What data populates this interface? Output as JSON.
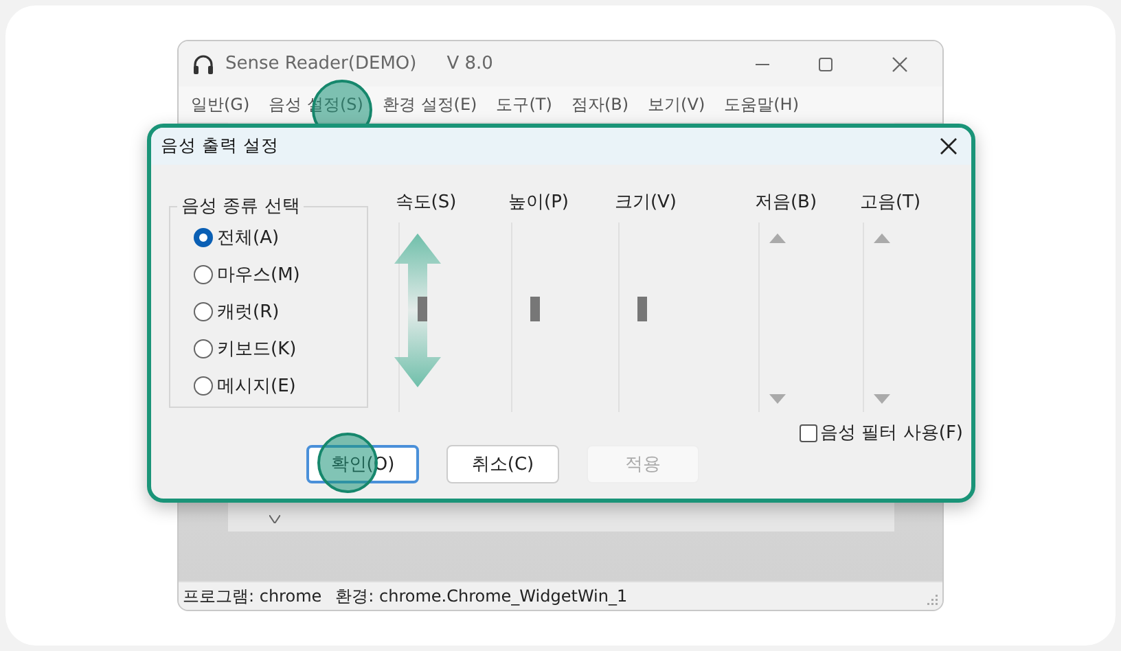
{
  "window": {
    "title": "Sense Reader(DEMO)",
    "version": "V 8.0"
  },
  "menu": [
    {
      "label": "일반(G)",
      "highlighted": false
    },
    {
      "label": "음성 설정(S)",
      "highlighted": true
    },
    {
      "label": "환경 설정(E)",
      "highlighted": false
    },
    {
      "label": "도구(T)",
      "highlighted": false
    },
    {
      "label": "점자(B)",
      "highlighted": false
    },
    {
      "label": "보기(V)",
      "highlighted": false
    },
    {
      "label": "도움말(H)",
      "highlighted": false
    }
  ],
  "dialog": {
    "title": "음성 출력 설정",
    "group": {
      "title": "음성 종류 선택",
      "options": [
        {
          "label": "전체(A)",
          "selected": true
        },
        {
          "label": "마우스(M)",
          "selected": false
        },
        {
          "label": "캐럿(R)",
          "selected": false
        },
        {
          "label": "키보드(K)",
          "selected": false
        },
        {
          "label": "메시지(E)",
          "selected": false
        }
      ]
    },
    "sliders": [
      {
        "label": "속도(S)",
        "kind": "thumb",
        "level": 0.55,
        "highlighted": true
      },
      {
        "label": "높이(P)",
        "kind": "thumb",
        "level": 0.55,
        "highlighted": false
      },
      {
        "label": "크기(V)",
        "kind": "thumb",
        "level": 0.55,
        "highlighted": false
      },
      {
        "label": "저음(B)",
        "kind": "arrows",
        "highlighted": false
      },
      {
        "label": "고음(T)",
        "kind": "arrows",
        "highlighted": false
      }
    ],
    "filter": {
      "label": "음성 필터 사용(F)",
      "checked": false
    },
    "buttons": [
      {
        "label": "확인(O)",
        "default": true,
        "disabled": false,
        "highlighted": true
      },
      {
        "label": "취소(C)",
        "default": false,
        "disabled": false,
        "highlighted": false
      },
      {
        "label": "적용",
        "default": false,
        "disabled": true,
        "highlighted": false
      }
    ]
  },
  "status_bar": {
    "program": "프로그램: chrome",
    "environment": "환경: chrome.Chrome_WidgetWin_1"
  }
}
